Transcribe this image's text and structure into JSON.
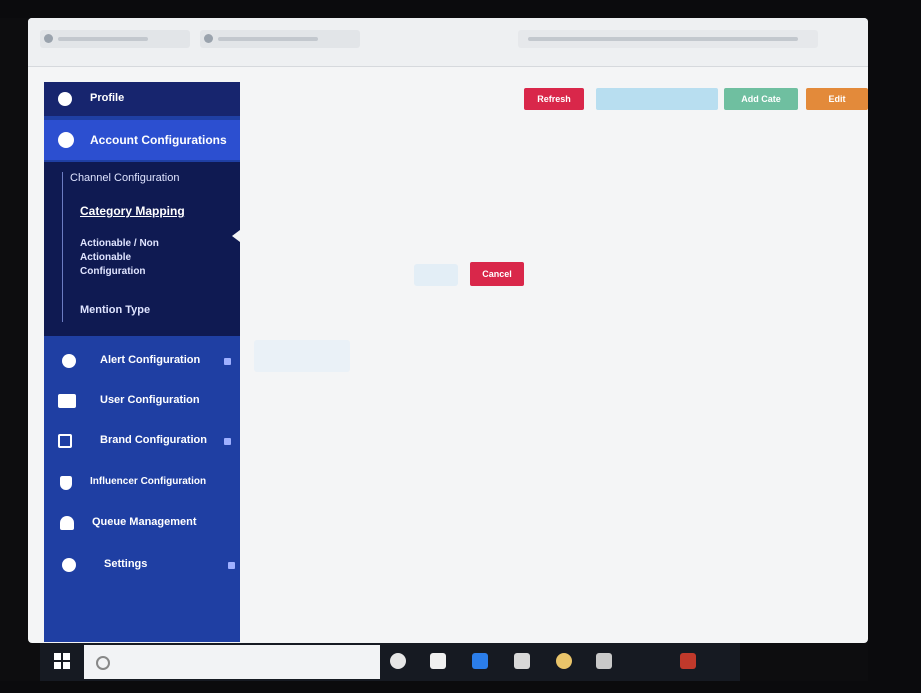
{
  "browser": {
    "tabs_count": 2
  },
  "sidebar": {
    "profile_label": "Profile",
    "account_configuration_label": "Account Configurations",
    "submenu": {
      "channel_configuration": "Channel Configuration",
      "category_mapping": "Category Mapping",
      "actionable_line1": "Actionable / Non",
      "actionable_line2": "Actionable",
      "actionable_line3": "Configuration",
      "mention_type": "Mention Type"
    },
    "items": [
      {
        "label": "Alert Configuration",
        "icon": "clock-icon"
      },
      {
        "label": "User Configuration",
        "icon": "user-card-icon"
      },
      {
        "label": "Brand Configuration",
        "icon": "home-icon"
      },
      {
        "label": "Influencer Configuration",
        "icon": "shield-icon"
      },
      {
        "label": "Queue Management",
        "icon": "bell-icon"
      },
      {
        "label": "Settings",
        "icon": "gear-icon"
      }
    ]
  },
  "toolbar": {
    "refresh_label": "Refresh",
    "add_label": "Add Cate",
    "edit_label": "Edit"
  },
  "dialog": {
    "cancel_label": "Cancel"
  },
  "colors": {
    "sidebar_bg": "#1f3fa3",
    "sidebar_active": "#2c4fd0",
    "submenu_bg": "#0f1a52",
    "button_red": "#d9274a",
    "button_lightblue": "#b8def0",
    "button_teal": "#6fbfa0",
    "button_orange": "#e38a3a"
  }
}
